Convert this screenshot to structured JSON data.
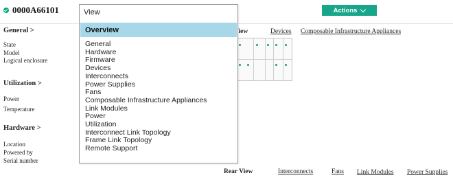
{
  "header": {
    "title": "0000A66101",
    "actions_label": "Actions"
  },
  "left": {
    "general": {
      "heading": "General >",
      "items": [
        "State",
        "Model",
        "Logical enclosure"
      ]
    },
    "utilization": {
      "heading": "Utilization >",
      "items": [
        "Power",
        "Temperature"
      ]
    },
    "hardware": {
      "heading": "Hardware >",
      "items": [
        "Location",
        "Powered by",
        "Serial number"
      ]
    }
  },
  "front_view": {
    "title_suffix": "View",
    "links": [
      "Devices",
      "Composable Infrastructure Appliances"
    ]
  },
  "rear_view": {
    "title": "Rear View",
    "links": [
      "Interconnects",
      "Fans",
      "Link Modules",
      "Power Supplies"
    ]
  },
  "dropdown": {
    "input_value": "View",
    "selected": "Overview",
    "options": [
      "General",
      "Hardware",
      "Firmware",
      "Devices",
      "Interconnects",
      "Power Supplies",
      "Fans",
      "Composable Infrastructure Appliances",
      "Link Modules",
      "Power",
      "Utilization",
      "Interconnect Link Topology",
      "Frame Link Topology",
      "Remote Support"
    ]
  },
  "colors": {
    "accent": "#17a58b",
    "status_ok": "#01a982",
    "highlight": "#a6d8ea"
  }
}
